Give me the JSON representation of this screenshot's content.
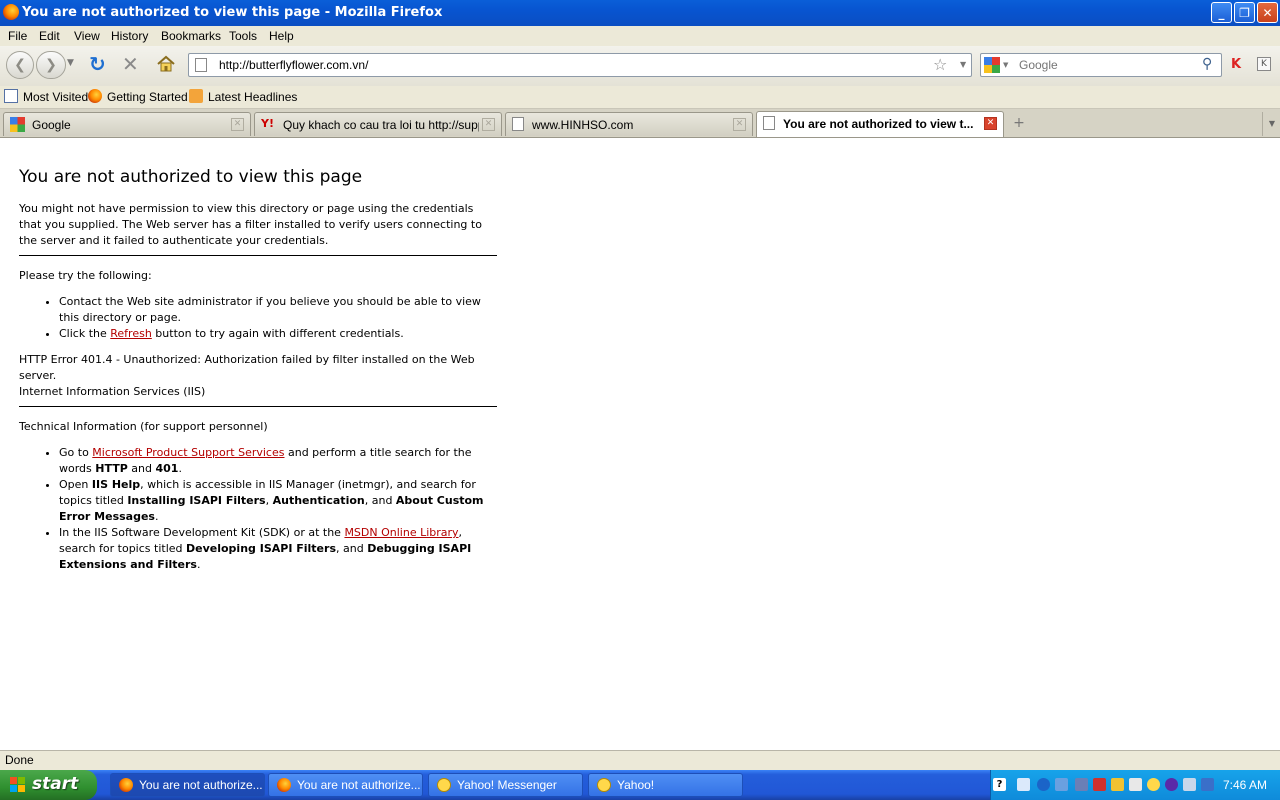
{
  "window": {
    "title": "You are not authorized to view this page - Mozilla Firefox",
    "controls": {
      "minimize": "_",
      "restore": "❐",
      "close": "✕"
    }
  },
  "menubar": {
    "items": [
      "File",
      "Edit",
      "View",
      "History",
      "Bookmarks",
      "Tools",
      "Help"
    ]
  },
  "navbar": {
    "url": "http://butterflyflower.com.vn/",
    "search_placeholder": "Google"
  },
  "bookmarks": {
    "items": [
      "Most Visited",
      "Getting Started",
      "Latest Headlines"
    ]
  },
  "tabs": [
    {
      "label": "Google",
      "active": false
    },
    {
      "label": "Quy khach co cau tra loi tu http://supp...",
      "active": false
    },
    {
      "label": "www.HINHSO.com",
      "active": false
    },
    {
      "label": "You are not authorized to view t...",
      "active": true
    }
  ],
  "page": {
    "heading": "You are not authorized to view this page",
    "intro": "You might not have permission to view this directory or page using the credentials that you supplied. The Web server has a filter installed to verify users connecting to the server and it failed to authenticate your credentials.",
    "try_label": "Please try the following:",
    "try_items": {
      "item1": "Contact the Web site administrator if you believe you should be able to view this directory or page.",
      "item2_pre": "Click the ",
      "item2_link": "Refresh",
      "item2_post": " button to try again with different credentials."
    },
    "error_line": "HTTP Error 401.4 - Unauthorized: Authorization failed by filter installed on the Web server.",
    "server_line": "Internet Information Services (IIS)",
    "tech_label": "Technical Information (for support personnel)",
    "tech": {
      "t1_pre": "Go to ",
      "t1_link": "Microsoft Product Support Services",
      "t1_mid": " and perform a title search for the words ",
      "t1_b1": "HTTP",
      "t1_and": " and ",
      "t1_b2": "401",
      "t1_end": ".",
      "t2_pre": "Open ",
      "t2_b1": "IIS Help",
      "t2_mid": ", which is accessible in IIS Manager (inetmgr), and search for topics titled ",
      "t2_b2": "Installing ISAPI Filters",
      "t2_c1": ", ",
      "t2_b3": "Authentication",
      "t2_c2": ", and ",
      "t2_b4": "About Custom Error Messages",
      "t2_end": ".",
      "t3_pre": "In the IIS Software Development Kit (SDK) or at the ",
      "t3_link": "MSDN Online Library",
      "t3_mid": ", search for topics titled ",
      "t3_b1": "Developing ISAPI Filters",
      "t3_c1": ", and ",
      "t3_b2": "Debugging ISAPI Extensions and Filters",
      "t3_end": "."
    }
  },
  "status": "Done",
  "taskbar": {
    "start": "start",
    "items": [
      {
        "label": "You are not authorize...",
        "active": true
      },
      {
        "label": "You are not authorize...",
        "active": false
      },
      {
        "label": "Yahoo! Messenger",
        "active": false
      },
      {
        "label": "Yahoo!",
        "active": false
      }
    ],
    "clock": "7:46 AM"
  },
  "colors": {
    "link": "#b30000",
    "titlebar": "#0a5fd8",
    "taskbar": "#245edb",
    "start": "#2f8f2f"
  }
}
